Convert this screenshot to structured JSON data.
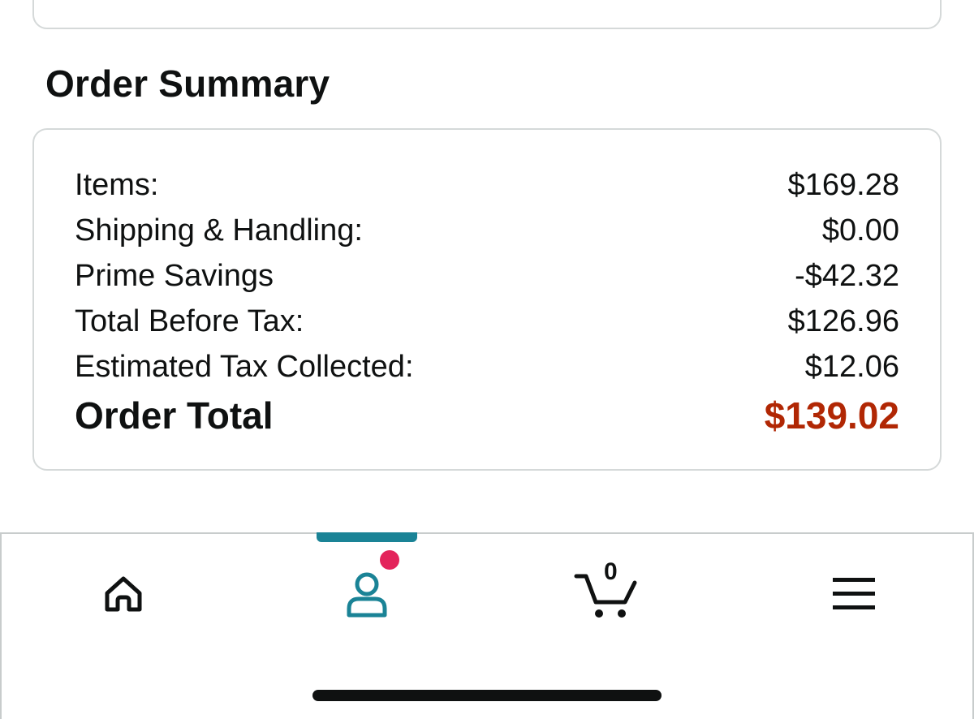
{
  "order_summary": {
    "title": "Order Summary",
    "rows": [
      {
        "label": "Items:",
        "value": "$169.28"
      },
      {
        "label": "Shipping & Handling:",
        "value": "$0.00"
      },
      {
        "label": "Prime Savings",
        "value": "-$42.32"
      },
      {
        "label": "Total Before Tax:",
        "value": "$126.96"
      },
      {
        "label": "Estimated Tax Collected:",
        "value": "$12.06"
      }
    ],
    "total": {
      "label": "Order Total",
      "value": "$139.02"
    }
  },
  "bottom_nav": {
    "items": [
      {
        "name": "home",
        "icon": "home-icon"
      },
      {
        "name": "account",
        "icon": "user-icon",
        "active": true,
        "notification_dot": true
      },
      {
        "name": "cart",
        "icon": "cart-icon",
        "count": "0"
      },
      {
        "name": "menu",
        "icon": "hamburger-menu-icon"
      }
    ]
  },
  "colors": {
    "total_price": "#b12704",
    "active_nav": "#1a8396",
    "notification": "#e3245b",
    "card_border": "#d5d9d9"
  }
}
